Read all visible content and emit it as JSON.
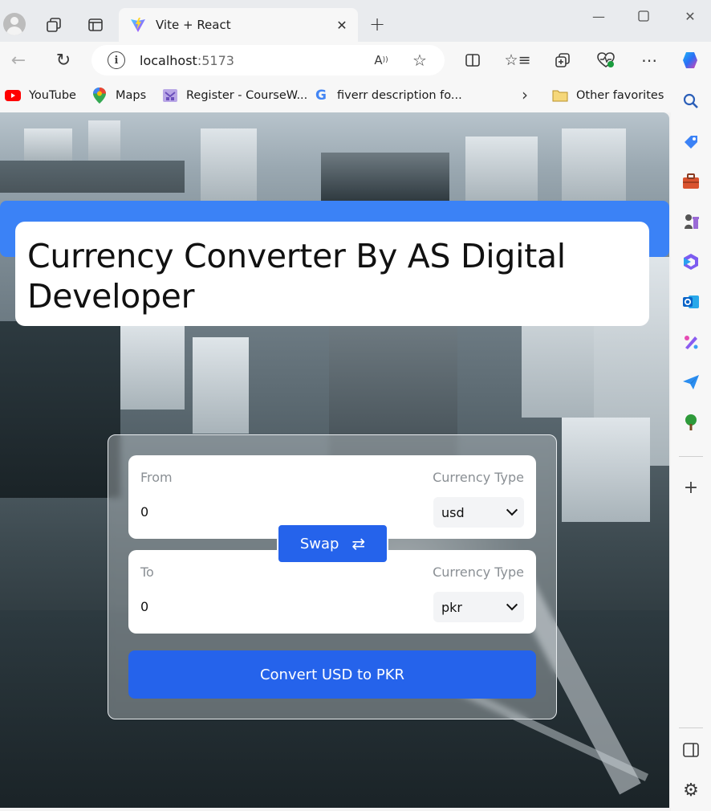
{
  "browser": {
    "tab_title": "Vite + React",
    "url_host": "localhost",
    "url_port": ":5173",
    "favorites": [
      {
        "label": "YouTube",
        "icon": "youtube-icon"
      },
      {
        "label": "Maps",
        "icon": "maps-pin-icon"
      },
      {
        "label": "Register - CourseW...",
        "icon": "course-icon"
      },
      {
        "label": "fiverr description fo...",
        "icon": "google-icon"
      }
    ],
    "other_favorites": "Other favorites"
  },
  "page": {
    "title": "Currency Converter By AS Digital Developer",
    "from": {
      "label": "From",
      "amount": "0",
      "currency_type_label": "Currency Type",
      "currency": "usd"
    },
    "to": {
      "label": "To",
      "amount": "0",
      "currency_type_label": "Currency Type",
      "currency": "pkr"
    },
    "swap_label": "Swap",
    "swap_icon": "⇄",
    "convert_label": "Convert USD to PKR"
  },
  "colors": {
    "accent": "#2563eb",
    "header_bar": "#3b82f6"
  }
}
